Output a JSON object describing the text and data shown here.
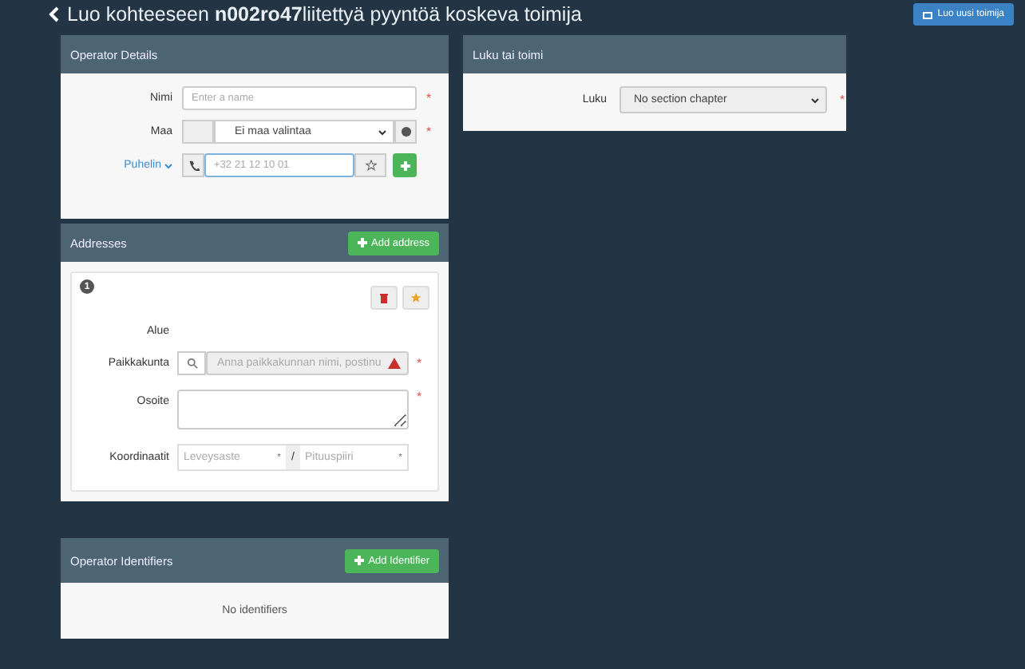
{
  "header": {
    "title": "Luo kohteeseen **n002ro47**liitettyä pyyntöä koskeva toimija",
    "button": "Luo uusi toimija"
  },
  "operator_details": {
    "title": "Operator Details",
    "name": {
      "label": "Nimi",
      "placeholder": "Enter a name",
      "required_mark": "*"
    },
    "country": {
      "label": "Maa",
      "value": "Ei maa valintaa",
      "required_mark": "*"
    },
    "phone": {
      "label": "Puhelin",
      "placeholder": "+32 21 12 10 01"
    }
  },
  "addresses": {
    "title": "Addresses",
    "button": "Add address",
    "items": [
      {
        "number": "1",
        "area_label": "Alue",
        "city": {
          "label": "Paikkakunta",
          "placeholder": "Anna paikkakunnan nimi, postinu",
          "required_mark": "*"
        },
        "address": {
          "label": "Osoite",
          "required_mark": "*"
        },
        "coordinates": {
          "label": "Koordinaatit",
          "latitude_placeholder": "Leveysaste",
          "latitude_mark": "*",
          "separator": "/",
          "longitude_placeholder": "Pituuspiiri",
          "longitude_mark": "*"
        }
      }
    ]
  },
  "identifiers": {
    "title": "Operator Identifiers",
    "button": "Add Identifier",
    "empty": "No identifiers"
  },
  "section": {
    "title": "Luku tai toimi",
    "chapter": {
      "label": "Luku",
      "value": "No section chapter",
      "required_mark": "*"
    }
  }
}
